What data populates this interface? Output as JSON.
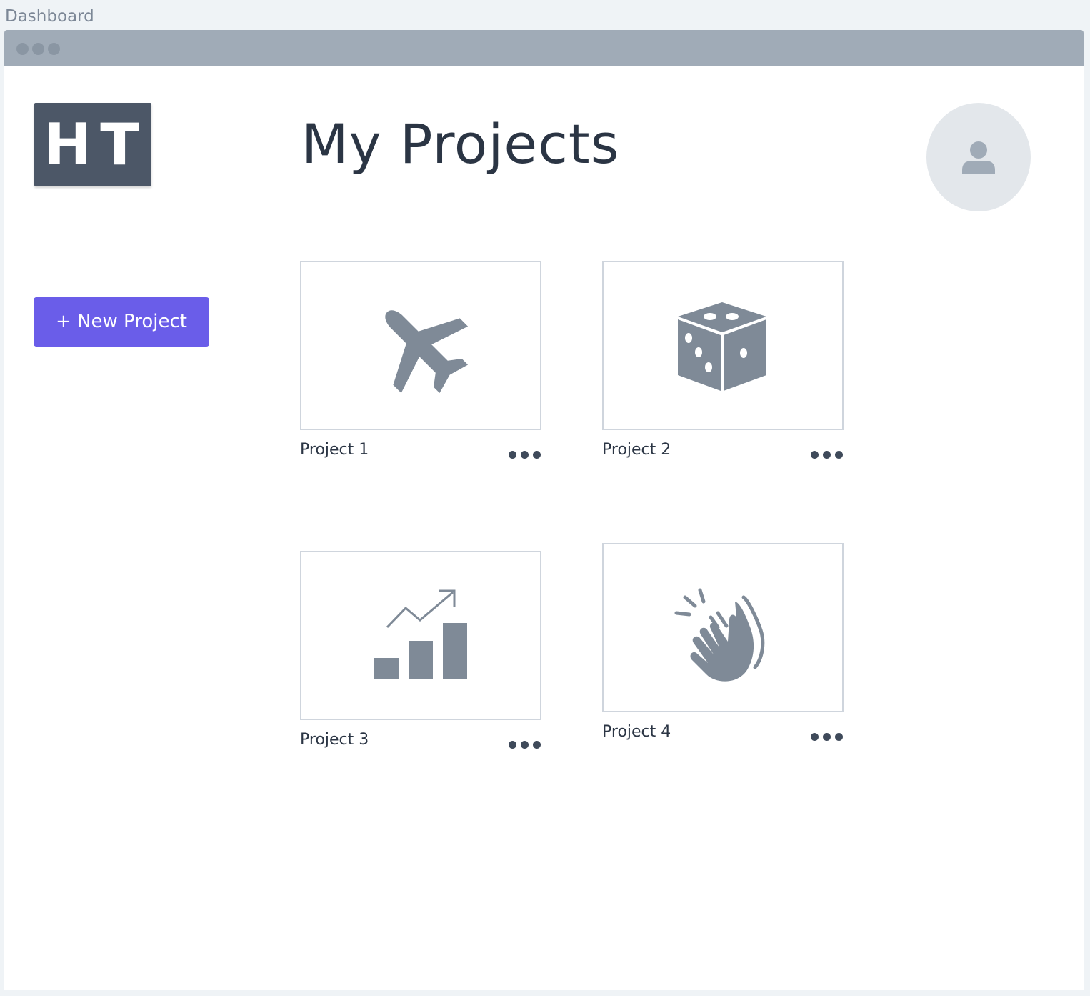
{
  "window_label": "Dashboard",
  "logo": {
    "text": "HT"
  },
  "header": {
    "title": "My Projects"
  },
  "sidebar": {
    "new_project_label": "+ New Project"
  },
  "projects": [
    {
      "name": "Project 1",
      "icon": "airplane-icon"
    },
    {
      "name": "Project 2",
      "icon": "dice-icon"
    },
    {
      "name": "Project 3",
      "icon": "growth-chart-icon"
    },
    {
      "name": "Project 4",
      "icon": "clapping-hands-icon"
    }
  ],
  "colors": {
    "accent": "#6a5de9",
    "logo_bg": "#4c5767",
    "icon": "#7f8a97",
    "text": "#2b3544"
  }
}
